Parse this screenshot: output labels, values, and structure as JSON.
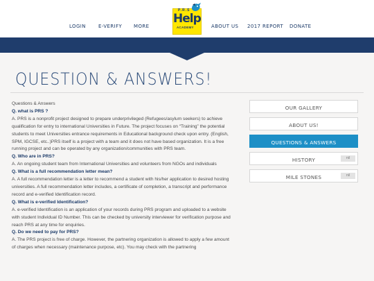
{
  "nav": {
    "login": "LOGIN",
    "everify": "E-VERIFY",
    "more": "MORE",
    "about": "ABOUT US",
    "report": "2017 REPORT",
    "donate": "DONATE"
  },
  "logo": {
    "prs": "P.R.S",
    "help": "Help",
    "academy": "ACADEMY"
  },
  "page_title": "QUESTION & ANSWERS!",
  "content": [
    {
      "type": "text",
      "text": "Questions & Answers"
    },
    {
      "type": "q",
      "text": "Q. what is PRS ?"
    },
    {
      "type": "text",
      "text": "A. PRS is a nonprofit project designed to prepare underprivileged (Refugees/asylum seekers) to achieve qualification for entry to international Universities in Future. The project focuses on “Training” the potential students to meet Universities entrance requirements in Educational background check upon entry. (English, SPM, IGCSE, etc..)PRS itself is a project with a team and it does not have based organization. It is a free running project and can be operated by any organization/communities with PRS team."
    },
    {
      "type": "q",
      "text": "Q. Who are in PRS?"
    },
    {
      "type": "text",
      "text": "A. An ongoing student team from International Universities and volunteers from NGOs and individuals"
    },
    {
      "type": "q",
      "text": "Q. What is a full recommendation letter mean?"
    },
    {
      "type": "text",
      "text": "A. A full recommendation letter is a letter to recommend a student with his/her application to desired hosting universities. A full recommendation letter includes, a certificate of completion, a transcript and performance record and e-verified Identification record."
    },
    {
      "type": "q",
      "text": "Q. What is e-verified Identification?"
    },
    {
      "type": "text",
      "text": "A. e-verified Identification is an application of your records during PRS program and uploaded to a website with student Individual ID Number. This can be checked by university interviewer for verification purpose and reach PRS at any time for enquiries."
    },
    {
      "type": "q",
      "text": "Q. Do we need to pay for PRS?"
    },
    {
      "type": "text",
      "text": "A. The PRS project is free of charge. However, the partnering organization is allowed to apply a few amount of charges when necessary (maintenance purpose, etc). You may check with the partnering"
    }
  ],
  "sidebar": [
    {
      "label": "OUR GALLERY",
      "active": false,
      "badge": ""
    },
    {
      "label": "ABOUT US!",
      "active": false,
      "badge": ""
    },
    {
      "label": "QUESTIONS & ANSWERS",
      "active": true,
      "badge": ""
    },
    {
      "label": "HISTORY",
      "active": false,
      "badge": "nil"
    },
    {
      "label": "MILE STONES",
      "active": false,
      "badge": "nil"
    }
  ],
  "colors": {
    "navy": "#1f3d6c",
    "accent": "#1d8fc6",
    "logo_yellow": "#ffe600"
  }
}
